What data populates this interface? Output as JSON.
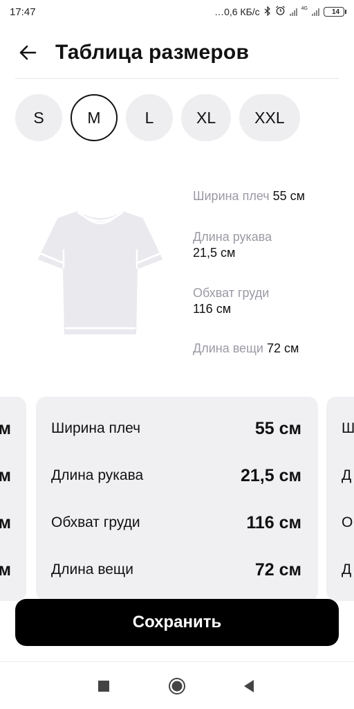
{
  "status_bar": {
    "time": "17:47",
    "network_speed": "…0,6 КБ/с",
    "network_type": "4G",
    "battery_level": "14",
    "icons": [
      "bluetooth-icon",
      "alarm-icon",
      "signal-icon",
      "signal-icon",
      "battery-icon"
    ]
  },
  "header": {
    "title": "Таблица размеров",
    "back_icon": "arrow-left-icon"
  },
  "sizes": [
    {
      "label": "S",
      "selected": false
    },
    {
      "label": "M",
      "selected": true
    },
    {
      "label": "L",
      "selected": false
    },
    {
      "label": "XL",
      "selected": false
    },
    {
      "label": "XXL",
      "selected": false
    }
  ],
  "illustration": {
    "icon": "tshirt-icon",
    "measurements": [
      {
        "label": "Ширина плеч",
        "value": "55 см"
      },
      {
        "label": "Длина рукава",
        "value": "21,5 см"
      },
      {
        "label": "Обхват груди",
        "value": "116 см"
      },
      {
        "label": "Длина вещи",
        "value": "72 см"
      }
    ]
  },
  "cards": {
    "left_partial": {
      "values": [
        "м",
        "м",
        "м",
        "м"
      ]
    },
    "center": {
      "rows": [
        {
          "label": "Ширина плеч",
          "value": "55 см"
        },
        {
          "label": "Длина рукава",
          "value": "21,5 см"
        },
        {
          "label": "Обхват груди",
          "value": "116 см"
        },
        {
          "label": "Длина вещи",
          "value": "72 см"
        }
      ]
    },
    "right_partial": {
      "labels": [
        "Ш",
        "Д",
        "О",
        "Д"
      ]
    }
  },
  "save_button": {
    "label": "Сохранить"
  },
  "nav_bar": {
    "icons": [
      "recents-square-icon",
      "home-circle-icon",
      "back-triangle-icon"
    ]
  },
  "colors": {
    "accent": "#000000",
    "chip_background": "#eeeef0",
    "card_background": "#f0f0f3",
    "muted_label": "#9a9aa4",
    "battery_low": "#e0282e"
  }
}
